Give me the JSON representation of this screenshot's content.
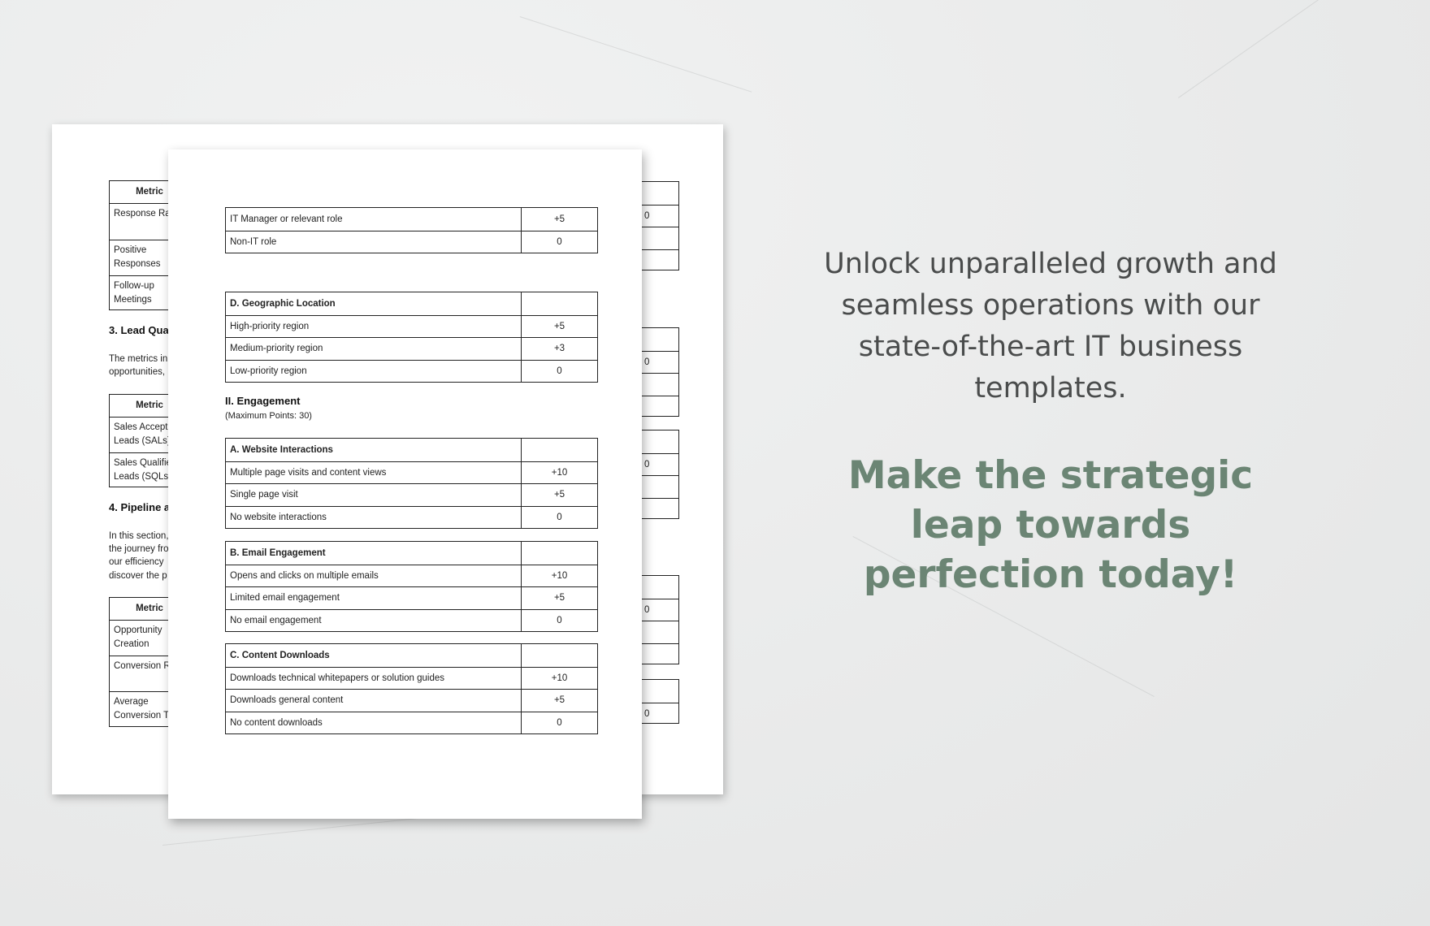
{
  "back_page": {
    "table1": {
      "header": "Metric",
      "rows": [
        "Response Ra",
        "Positive Responses",
        "Follow-up Meetings"
      ]
    },
    "section3": {
      "heading": "3. Lead Qua",
      "paragraph": [
        "The metrics in",
        "opportunities,"
      ]
    },
    "table2": {
      "header": "Metric",
      "rows": [
        "Sales Accept Leads (SALs)",
        "Sales Qualifie Leads (SQLs)"
      ]
    },
    "section4": {
      "heading": "4. Pipeline a",
      "paragraph": [
        "In this section,",
        "the journey fro",
        "our efficiency",
        "discover the p"
      ]
    },
    "table3": {
      "header": "Metric",
      "rows": [
        "Opportunity Creation",
        "Conversion R",
        "Average Conversion T"
      ]
    },
    "right_fragments": [
      "0",
      "0",
      "0",
      "0",
      "0"
    ]
  },
  "front_page": {
    "role_table": [
      {
        "label": "IT Manager or relevant role",
        "points": "+5"
      },
      {
        "label": "Non-IT role",
        "points": "0"
      }
    ],
    "geo_table": {
      "title": "D. Geographic Location",
      "rows": [
        {
          "label": "High-priority region",
          "points": "+5"
        },
        {
          "label": "Medium-priority region",
          "points": "+3"
        },
        {
          "label": "Low-priority region",
          "points": "0"
        }
      ]
    },
    "engagement": {
      "heading": "II. Engagement",
      "subtitle": "(Maximum Points: 30)"
    },
    "website_table": {
      "title": "A. Website Interactions",
      "rows": [
        {
          "label": "Multiple page visits and content views",
          "points": "+10"
        },
        {
          "label": "Single page visit",
          "points": "+5"
        },
        {
          "label": "No website interactions",
          "points": "0"
        }
      ]
    },
    "email_table": {
      "title": "B. Email Engagement",
      "rows": [
        {
          "label": "Opens and clicks on multiple emails",
          "points": "+10"
        },
        {
          "label": "Limited email engagement",
          "points": "+5"
        },
        {
          "label": "No email engagement",
          "points": "0"
        }
      ]
    },
    "content_table": {
      "title": "C. Content Downloads",
      "rows": [
        {
          "label": "Downloads technical whitepapers or solution guides",
          "points": "+10"
        },
        {
          "label": "Downloads general content",
          "points": "+5"
        },
        {
          "label": "No content downloads",
          "points": "0"
        }
      ]
    }
  },
  "promo": {
    "tagline": "Unlock unparalleled growth and seamless operations with our state-of-the-art IT business templates.",
    "cta": "Make the strategic leap towards perfection today!",
    "colors": {
      "tagline": "#4a4c4c",
      "cta": "#6b8574"
    }
  }
}
